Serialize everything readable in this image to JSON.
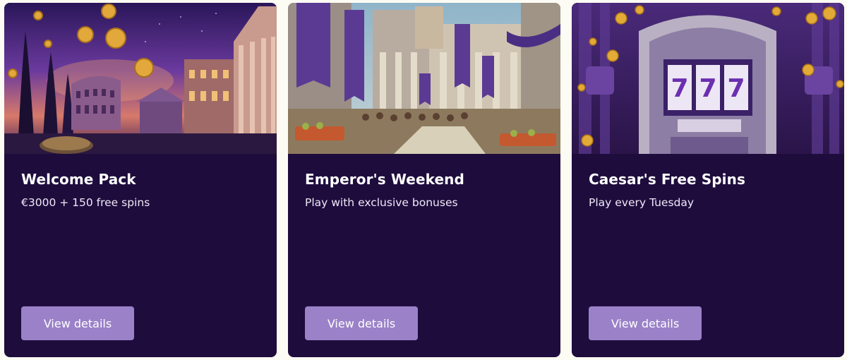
{
  "promotions": [
    {
      "title": "Welcome Pack",
      "subtitle": "€3000 + 150 free spins",
      "button_label": "View details",
      "image": "rome-night-colosseum-coins-image"
    },
    {
      "title": "Emperor's Weekend",
      "subtitle": "Play with exclusive bonuses",
      "button_label": "View details",
      "image": "roman-forum-market-image"
    },
    {
      "title": "Caesar's Free Spins",
      "subtitle": "Play every Tuesday",
      "button_label": "View details",
      "image": "slot-machine-777-image"
    }
  ],
  "colors": {
    "page_background": "#fdfcf4",
    "card_background": "#1e0c3d",
    "button_background": "#9a81c8",
    "title_text": "#ffffff"
  }
}
